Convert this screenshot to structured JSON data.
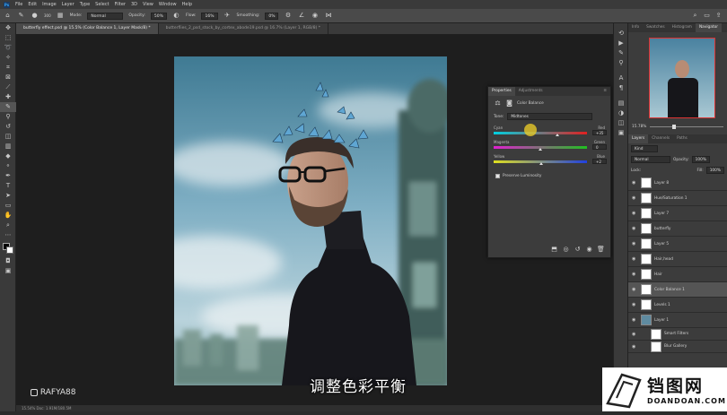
{
  "menu": {
    "items": [
      "File",
      "Edit",
      "Image",
      "Layer",
      "Type",
      "Select",
      "Filter",
      "3D",
      "View",
      "Window",
      "Help"
    ]
  },
  "options": {
    "mode_label": "Mode:",
    "mode_value": "Normal",
    "opacity_label": "Opacity:",
    "opacity_value": "50%",
    "flow_label": "Flow:",
    "flow_value": "16%",
    "smoothing_label": "Smoothing:",
    "smoothing_value": "0%",
    "brush_size": "300"
  },
  "tabs": [
    {
      "label": "butterfly effect.psd @ 15.5% (Color Balance 1, Layer Mask/8) *"
    },
    {
      "label": "butterflies_2_psd_stock_by_cortex_abode19.psd @ 16.7% (Layer 1, RGB/8) *"
    }
  ],
  "properties": {
    "tab1": "Properties",
    "tab2": "Adjustments",
    "title": "Color Balance",
    "tone_label": "Tone:",
    "tone_value": "Midtones",
    "sliders": [
      {
        "left": "Cyan",
        "right": "Red",
        "value": "+35",
        "pct": 0.68,
        "color": "cyan-red"
      },
      {
        "left": "Magenta",
        "right": "Green",
        "value": "0",
        "pct": 0.5,
        "color": "magenta-green"
      },
      {
        "left": "Yellow",
        "right": "Blue",
        "value": "+2",
        "pct": 0.51,
        "color": "yellow-blue"
      }
    ],
    "preserve_label": "Preserve Luminosity"
  },
  "navigator": {
    "tabs": [
      "Info",
      "Swatches",
      "Histogram",
      "Navigator"
    ],
    "zoom": "15.78%"
  },
  "layers_panel": {
    "tabs": [
      "Layers",
      "Channels",
      "Paths"
    ],
    "kind": "Kind",
    "blend": "Normal",
    "opacity_label": "Opacity:",
    "opacity_value": "100%",
    "lock_label": "Lock:",
    "fill_label": "Fill:",
    "fill_value": "100%",
    "layers": [
      {
        "name": "Layer 8",
        "selected": false
      },
      {
        "name": "Hue/Saturation 1",
        "selected": false
      },
      {
        "name": "Layer 7",
        "selected": false
      },
      {
        "name": "butterfly",
        "selected": false
      },
      {
        "name": "Layer 5",
        "selected": false
      },
      {
        "name": "Hair,head",
        "selected": false
      },
      {
        "name": "Hair",
        "selected": false
      },
      {
        "name": "Color Balance 1",
        "selected": true
      },
      {
        "name": "Levels 1",
        "selected": false
      },
      {
        "name": "Layer 1",
        "selected": false
      },
      {
        "name": "Smart Filters",
        "selected": false
      },
      {
        "name": "Blur Gallery",
        "selected": false
      }
    ]
  },
  "subtitle": "调整色彩平衡",
  "watermark": "RAFYA88",
  "logo": {
    "cn": "铛图网",
    "en": "DOANDOAN.COM"
  },
  "status": "15.54%   Doc: 1.91M/180.5M"
}
